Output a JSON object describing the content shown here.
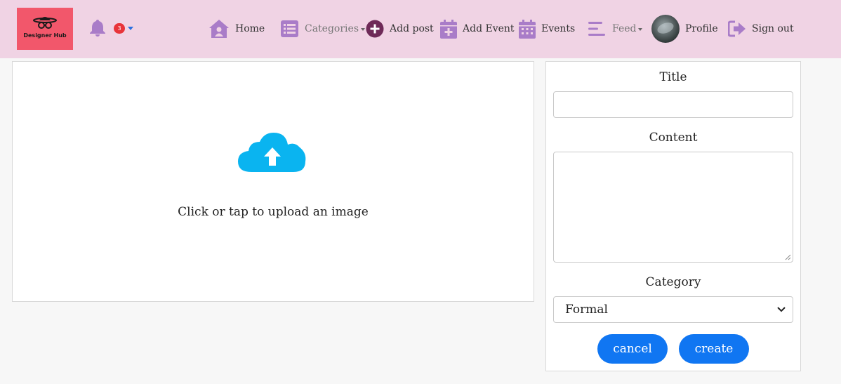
{
  "brand": {
    "name": "Designer Hub"
  },
  "notifications": {
    "count": "3"
  },
  "nav": {
    "home": "Home",
    "categories": "Categories",
    "add_post": "Add post",
    "add_event": "Add Event",
    "events": "Events",
    "feed": "Feed",
    "profile": "Profile",
    "sign_out": "Sign out"
  },
  "colors": {
    "navbar_bg": "#f0d3e4",
    "icon_purple": "#a97cc8",
    "logo_bg": "#f2576b",
    "primary_button": "#1076f2",
    "cloud_blue": "#0ab4f0"
  },
  "upload": {
    "prompt": "Click or tap to upload an image"
  },
  "form": {
    "title_label": "Title",
    "title_value": "",
    "content_label": "Content",
    "content_value": "",
    "category_label": "Category",
    "category_selected": "Formal",
    "cancel_label": "cancel",
    "create_label": "create"
  }
}
